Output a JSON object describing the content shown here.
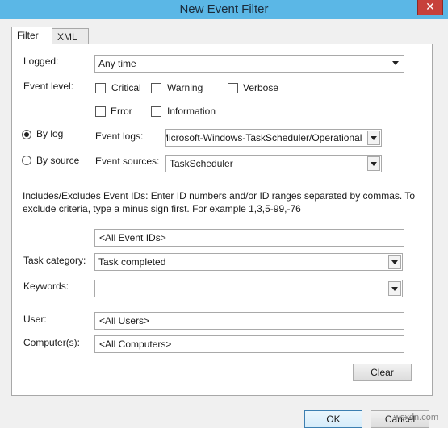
{
  "window": {
    "title": "New Event Filter",
    "close_glyph": "✕"
  },
  "tabs": [
    {
      "label": "Filter"
    },
    {
      "label": "XML"
    }
  ],
  "logged": {
    "label": "Logged:",
    "value": "Any time"
  },
  "event_level": {
    "label": "Event level:",
    "options": [
      {
        "label": "Critical",
        "checked": false
      },
      {
        "label": "Warning",
        "checked": false
      },
      {
        "label": "Verbose",
        "checked": false
      },
      {
        "label": "Error",
        "checked": false
      },
      {
        "label": "Information",
        "checked": false
      }
    ]
  },
  "by_log": {
    "label": "By log",
    "selected": true
  },
  "by_source": {
    "label": "By source",
    "selected": false
  },
  "event_logs": {
    "label": "Event logs:",
    "value": "Microsoft-Windows-TaskScheduler/Operational"
  },
  "event_sources": {
    "label": "Event sources:",
    "value": "TaskScheduler"
  },
  "event_ids": {
    "note": "Includes/Excludes Event IDs: Enter ID numbers and/or ID ranges separated by commas. To exclude criteria, type a minus sign first. For example 1,3,5-99,-76",
    "value": "<All Event IDs>"
  },
  "task_category": {
    "label": "Task category:",
    "value": "Task completed"
  },
  "keywords": {
    "label": "Keywords:",
    "value": ""
  },
  "user": {
    "label": "User:",
    "value": "<All Users>"
  },
  "computers": {
    "label": "Computer(s):",
    "value": "<All Computers>"
  },
  "buttons": {
    "clear": "Clear",
    "ok": "OK",
    "cancel": "Cancel"
  },
  "watermark": "wsxdn.com"
}
